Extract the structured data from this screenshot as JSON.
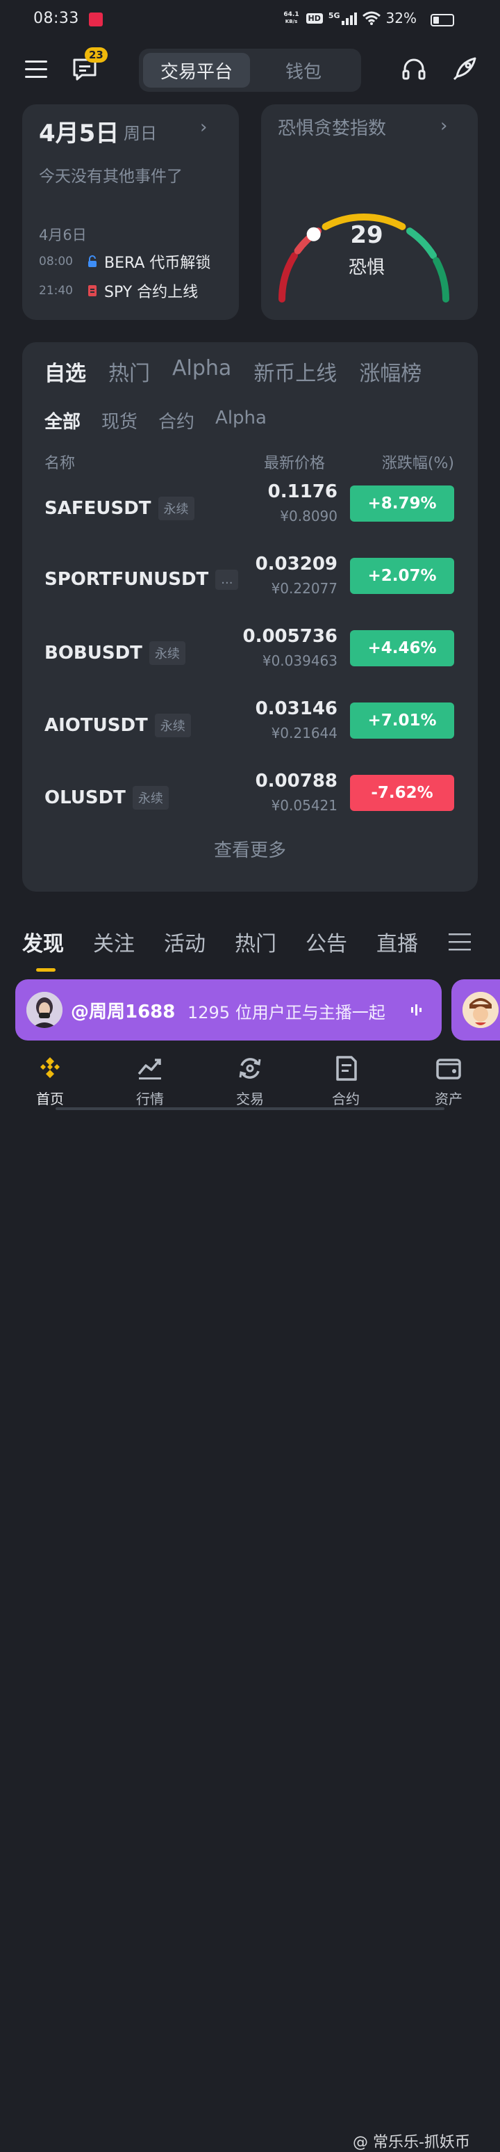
{
  "status_bar": {
    "time": "08:33",
    "net_speed_value": "64.1",
    "net_speed_unit": "KB/s",
    "hd": "HD",
    "signal": "5G",
    "battery_text": "32%",
    "battery_level": 0.32
  },
  "top_nav": {
    "message_badge": "23",
    "tab_trade": "交易平台",
    "tab_wallet": "钱包",
    "icons": [
      "menu-icon",
      "message-icon",
      "headset-icon",
      "rocket-icon"
    ]
  },
  "date_card": {
    "date": "4月5日",
    "weekday": "周日",
    "no_events": "今天没有其他事件了",
    "next_date": "4月6日",
    "events": [
      {
        "time": "08:00",
        "icon": "lock-icon",
        "text": "BERA 代币解锁"
      },
      {
        "time": "21:40",
        "icon": "document-icon",
        "text": "SPY 合约上线"
      }
    ]
  },
  "fear_greed": {
    "title": "恐惧贪婪指数",
    "value": "29",
    "label": "恐惧",
    "index_value": 29,
    "colors": {
      "red": "#c2202f",
      "orange": "#e0484f",
      "yellow": "#f0b90b",
      "green": "#2ebd85",
      "deep_green": "#1a9a62"
    }
  },
  "market": {
    "tabs": [
      "自选",
      "热门",
      "Alpha",
      "新币上线",
      "涨幅榜"
    ],
    "sub_tabs": [
      "全部",
      "现货",
      "合约",
      "Alpha"
    ],
    "headers": {
      "name": "名称",
      "price": "最新价格",
      "change": "涨跌幅(%)"
    },
    "rows": [
      {
        "symbol": "SAFEUSDT",
        "tag": "永续",
        "price": "0.1176",
        "cny": "¥0.8090",
        "change": "+8.79%",
        "dir": "up"
      },
      {
        "symbol": "SPORTFUNUSDT",
        "tag": "...",
        "price": "0.03209",
        "cny": "¥0.22077",
        "change": "+2.07%",
        "dir": "up"
      },
      {
        "symbol": "BOBUSDT",
        "tag": "永续",
        "price": "0.005736",
        "cny": "¥0.039463",
        "change": "+4.46%",
        "dir": "up"
      },
      {
        "symbol": "AIOTUSDT",
        "tag": "永续",
        "price": "0.03146",
        "cny": "¥0.21644",
        "change": "+7.01%",
        "dir": "up"
      },
      {
        "symbol": "OLUSDT",
        "tag": "永续",
        "price": "0.00788",
        "cny": "¥0.05421",
        "change": "-7.62%",
        "dir": "down"
      }
    ],
    "more": "查看更多",
    "colors": {
      "up": "#2ebd85",
      "down": "#f6465d"
    }
  },
  "feed_tabs": [
    "发现",
    "关注",
    "活动",
    "热门",
    "公告",
    "直播"
  ],
  "live_banner": {
    "host": "@周周1688",
    "text": "1295 位用户正与主播一起"
  },
  "bottom_nav": [
    {
      "label": "首页",
      "icon": "home-icon"
    },
    {
      "label": "行情",
      "icon": "chart-icon"
    },
    {
      "label": "交易",
      "icon": "trade-icon"
    },
    {
      "label": "合约",
      "icon": "futures-icon"
    },
    {
      "label": "资产",
      "icon": "wallet-icon"
    }
  ],
  "watermark": "@ 常乐乐-抓妖币",
  "accent": "#f0b90b"
}
